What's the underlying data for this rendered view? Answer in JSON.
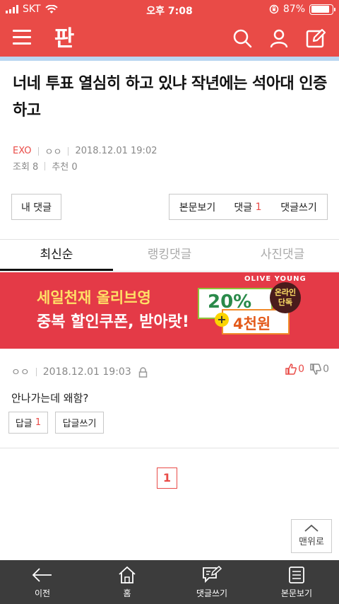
{
  "status_bar": {
    "carrier": "SKT",
    "time": "오후 7:08",
    "battery": "87%",
    "battery_level": 0.87
  },
  "header": {
    "logo_text": "판",
    "icons": [
      "menu-icon",
      "search-icon",
      "user-icon",
      "write-icon"
    ]
  },
  "article": {
    "title": "너네 투표 열심히 하고 있냐 작년에는 석아대 인증하고",
    "category": "EXO",
    "author": "ㅇㅇ",
    "date": "2018.12.01 19:02",
    "views_label": "조회 8",
    "recommend_label": "추천 0"
  },
  "actions": {
    "my_comments": "내 댓글",
    "view_post": "본문보기",
    "comments_label": "댓글",
    "comments_count": "1",
    "write_comment": "댓글쓰기"
  },
  "tabs": [
    {
      "label": "최신순",
      "active": true
    },
    {
      "label": "랭킹댓글",
      "active": false
    },
    {
      "label": "사진댓글",
      "active": false
    }
  ],
  "ad": {
    "brand": "OLIVE YOUNG",
    "line1": "세일천재 올리브영",
    "line2": "중복 할인쿠폰, 받아랏!",
    "coupon1": "20%",
    "coupon2": "4천원",
    "badge": "온라인 단독"
  },
  "comment": {
    "author": "ㅇㅇ",
    "date": "2018.12.01 19:03",
    "likes": "0",
    "dislikes": "0",
    "text": "안나가는데 왜함?",
    "reply_label": "답글",
    "reply_count": "1",
    "write_reply": "답글쓰기"
  },
  "pagination": {
    "current": "1"
  },
  "to_top": "맨위로",
  "bottom_nav": [
    {
      "label": "이전",
      "icon": "back-arrow-icon"
    },
    {
      "label": "홈",
      "icon": "home-icon"
    },
    {
      "label": "댓글쓰기",
      "icon": "comment-write-icon"
    },
    {
      "label": "본문보기",
      "icon": "document-icon"
    }
  ],
  "colors": {
    "brand": "#e94b47",
    "accent_line": "#b9d6f1",
    "bottom_bar": "#3c3c3c"
  }
}
